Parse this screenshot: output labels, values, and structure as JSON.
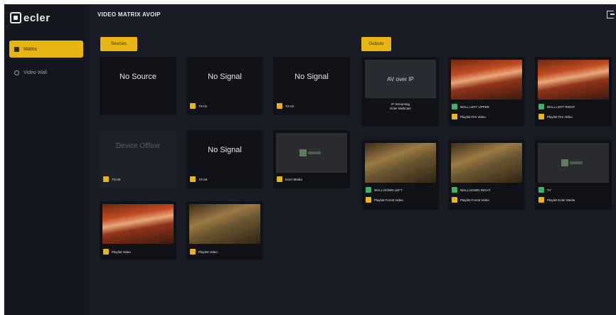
{
  "app": {
    "logo_text": "ecler",
    "page_title": "VIDEO MATRIX AVOIP",
    "nav": [
      {
        "label": "Matrix",
        "active": true
      },
      {
        "label": "Video Wall",
        "active": false
      }
    ]
  },
  "sections": {
    "left_button": "Sources",
    "right_button": "Outputs"
  },
  "sources": [
    {
      "type": "text",
      "text": "No Source"
    },
    {
      "type": "text",
      "text": "No Signal",
      "tag": "TX-01"
    },
    {
      "type": "text",
      "text": "No Signal",
      "tag": "TX-02"
    },
    {
      "type": "offline",
      "text": "Device Offline",
      "tag": "TX-03"
    },
    {
      "type": "text",
      "text": "No Signal",
      "tag": "TX-04"
    },
    {
      "type": "image",
      "image": "dark",
      "tag": "Ecler Media"
    },
    {
      "type": "image",
      "image": "fire",
      "tag": "Playlist Video"
    },
    {
      "type": "image",
      "image": "forest",
      "tag": "Playlist Video"
    }
  ],
  "outputs": [
    {
      "type": "av",
      "box_text": "AV over IP",
      "sub1": "IP Streaming",
      "sub2": "Ecler Multicast"
    },
    {
      "type": "image",
      "image": "fire",
      "tag1": "WALL LEFT UPPER",
      "tag2": "Playlist Fire Video"
    },
    {
      "type": "image",
      "image": "fire",
      "tag1": "WALL LEFT RIGHT",
      "tag2": "Playlist Fire Video"
    },
    {
      "type": "image",
      "image": "forest",
      "tag1": "WALL DOWN LEFT",
      "tag2": "Playlist Forest Video"
    },
    {
      "type": "image",
      "image": "forest",
      "tag1": "WALL DOWN RIGHT",
      "tag2": "Playlist Forest Video"
    },
    {
      "type": "image",
      "image": "dark",
      "tag1": "TV",
      "tag2": "Playlist Ecler Media"
    }
  ]
}
